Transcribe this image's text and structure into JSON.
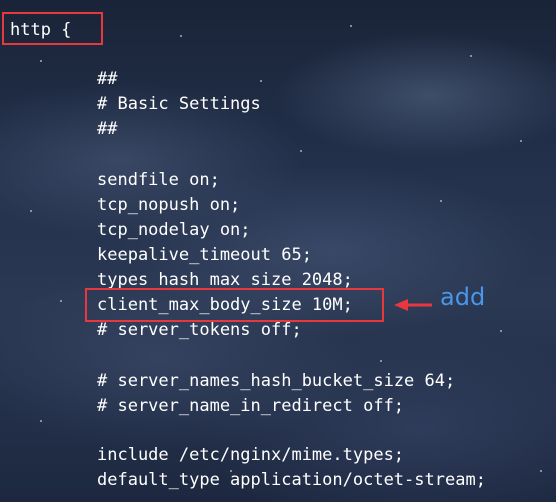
{
  "code": {
    "lines": [
      "http {",
      "##",
      "# Basic Settings",
      "##",
      "sendfile on;",
      "tcp_nopush on;",
      "tcp_nodelay on;",
      "keepalive_timeout 65;",
      "types_hash_max_size 2048;",
      "client_max_body_size 10M;",
      "# server_tokens off;",
      "# server_names_hash_bucket_size 64;",
      "# server_name_in_redirect off;",
      "include /etc/nginx/mime.types;",
      "default_type application/octet-stream;"
    ]
  },
  "annotation": {
    "label": "add"
  },
  "colors": {
    "text": "#ffffff",
    "highlight_box": "#e8383d",
    "annotation": "#4a96e8"
  }
}
